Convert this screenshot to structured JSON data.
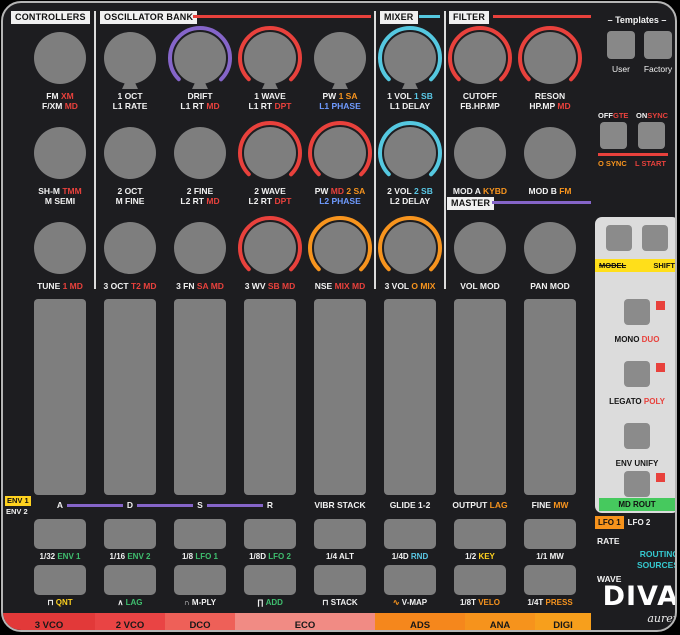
{
  "palette": {
    "w": "#f2f2f2",
    "r": "#e8413c",
    "o": "#f7941e",
    "c": "#5ac8e6",
    "b": "#6f9bff",
    "g": "#3fbf6f",
    "y": "#ffd21f",
    "p": "#8565c9",
    "k": "#141414"
  },
  "arc_colors": {
    "r": "#e8413c",
    "p": "#8565c9",
    "c": "#55c8e0",
    "o": "#f7941e"
  },
  "headers": {
    "controllers": "CONTROLLERS",
    "oscillator_bank": "OSCILLATOR BANK",
    "mixer": "MIXER",
    "filter": "FILTER",
    "master": "MASTER"
  },
  "knob_rows": [
    [
      {
        "l1": [
          [
            "FM ",
            "w"
          ],
          [
            "XM",
            "r"
          ]
        ],
        "l2": [
          [
            "F/XM ",
            "w"
          ],
          [
            "MD",
            "r"
          ]
        ],
        "arc": null,
        "marker": false
      },
      {
        "l1": [
          [
            "1 OCT",
            "w"
          ]
        ],
        "l2": [
          [
            "L1 RATE",
            "w"
          ]
        ],
        "arc": null,
        "marker": true
      },
      {
        "l1": [
          [
            "DRIFT",
            "w"
          ]
        ],
        "l2": [
          [
            "L1 RT ",
            "w"
          ],
          [
            "MD",
            "r"
          ]
        ],
        "arc": "p",
        "marker": true
      },
      {
        "l1": [
          [
            "1 WAVE",
            "w"
          ]
        ],
        "l2": [
          [
            "L1 RT ",
            "w"
          ],
          [
            "DPT",
            "r"
          ]
        ],
        "arc": "r",
        "marker": true
      },
      {
        "l1": [
          [
            "PW ",
            "w"
          ],
          [
            "1 SA",
            "o"
          ]
        ],
        "l2": [
          [
            "L1 PHASE",
            "b"
          ]
        ],
        "arc": null,
        "marker": true
      },
      {
        "l1": [
          [
            "1 VOL ",
            "w"
          ],
          [
            "1 SB",
            "c"
          ]
        ],
        "l2": [
          [
            "L1 DELAY",
            "w"
          ]
        ],
        "arc": "c",
        "marker": true
      },
      {
        "l1": [
          [
            "CUTOFF",
            "w"
          ]
        ],
        "l2": [
          [
            "FB.HP.MP",
            "w"
          ]
        ],
        "arc": "r",
        "marker": false
      },
      {
        "l1": [
          [
            "RESON",
            "w"
          ]
        ],
        "l2": [
          [
            "HP.MP ",
            "w"
          ],
          [
            "MD",
            "r"
          ]
        ],
        "arc": "r",
        "marker": false
      }
    ],
    [
      {
        "l1": [
          [
            "SH-M ",
            "w"
          ],
          [
            "TMM",
            "r"
          ]
        ],
        "l2": [
          [
            "M SEMI",
            "w"
          ]
        ],
        "arc": null,
        "marker": false
      },
      {
        "l1": [
          [
            "2 OCT",
            "w"
          ]
        ],
        "l2": [
          [
            "M FINE",
            "w"
          ]
        ],
        "arc": null,
        "marker": false
      },
      {
        "l1": [
          [
            "2 FINE",
            "w"
          ]
        ],
        "l2": [
          [
            "L2 RT ",
            "w"
          ],
          [
            "MD",
            "r"
          ]
        ],
        "arc": null,
        "marker": false
      },
      {
        "l1": [
          [
            "2 WAVE",
            "w"
          ]
        ],
        "l2": [
          [
            "L2 RT ",
            "w"
          ],
          [
            "DPT",
            "r"
          ]
        ],
        "arc": "r",
        "marker": false
      },
      {
        "l1": [
          [
            "PW ",
            "w"
          ],
          [
            "MD ",
            "r"
          ],
          [
            "2 SA",
            "o"
          ]
        ],
        "l2": [
          [
            "L2 PHASE",
            "b"
          ]
        ],
        "arc": "r",
        "marker": false
      },
      {
        "l1": [
          [
            "2 VOL ",
            "w"
          ],
          [
            "2 SB",
            "c"
          ]
        ],
        "l2": [
          [
            "L2 DELAY",
            "w"
          ]
        ],
        "arc": "c",
        "marker": false
      },
      {
        "l1": [
          [
            "MOD A ",
            "w"
          ],
          [
            "KYBD",
            "o"
          ]
        ],
        "l2": null,
        "arc": null,
        "marker": false
      },
      {
        "l1": [
          [
            "MOD B ",
            "w"
          ],
          [
            "FM",
            "o"
          ]
        ],
        "l2": null,
        "arc": null,
        "marker": false
      }
    ],
    [
      {
        "l1": [
          [
            "TUNE ",
            "w"
          ],
          [
            "1 MD",
            "r"
          ]
        ],
        "l2": null,
        "arc": null,
        "marker": false
      },
      {
        "l1": [
          [
            "3 OCT ",
            "w"
          ],
          [
            "T2 MD",
            "r"
          ]
        ],
        "l2": null,
        "arc": null,
        "marker": false
      },
      {
        "l1": [
          [
            "3 FN ",
            "w"
          ],
          [
            "SA MD",
            "r"
          ]
        ],
        "l2": null,
        "arc": null,
        "marker": false
      },
      {
        "l1": [
          [
            "3 WV ",
            "w"
          ],
          [
            "SB MD",
            "r"
          ]
        ],
        "l2": null,
        "arc": "r",
        "marker": false
      },
      {
        "l1": [
          [
            "NSE ",
            "w"
          ],
          [
            "MIX MD",
            "r"
          ]
        ],
        "l2": null,
        "arc": "o",
        "marker": false
      },
      {
        "l1": [
          [
            "3 VOL ",
            "w"
          ],
          [
            "O MIX",
            "o"
          ]
        ],
        "l2": null,
        "arc": "o",
        "marker": false
      },
      {
        "l1": [
          [
            "VOL MOD",
            "w"
          ]
        ],
        "l2": null,
        "arc": null,
        "marker": false
      },
      {
        "l1": [
          [
            "PAN MOD",
            "w"
          ]
        ],
        "l2": null,
        "arc": null,
        "marker": false
      }
    ]
  ],
  "faders": [
    {
      "label": [
        [
          "A",
          "w"
        ]
      ]
    },
    {
      "label": [
        [
          "D",
          "w"
        ]
      ]
    },
    {
      "label": [
        [
          "S",
          "w"
        ]
      ]
    },
    {
      "label": [
        [
          "R",
          "w"
        ]
      ]
    },
    {
      "label": [
        [
          "VIBR STACK",
          "w"
        ]
      ]
    },
    {
      "label": [
        [
          "GLIDE 1-2",
          "w"
        ]
      ]
    },
    {
      "label": [
        [
          "OUTPUT ",
          "w"
        ],
        [
          "LAG",
          "o"
        ]
      ]
    },
    {
      "label": [
        [
          "FINE ",
          "w"
        ],
        [
          "MW",
          "o"
        ]
      ]
    }
  ],
  "button_row1": [
    {
      "label": [
        [
          "1/32 ",
          "w"
        ],
        [
          "ENV 1",
          "g"
        ]
      ]
    },
    {
      "label": [
        [
          "1/16 ",
          "w"
        ],
        [
          "ENV 2",
          "g"
        ]
      ]
    },
    {
      "label": [
        [
          "1/8 ",
          "w"
        ],
        [
          "LFO 1",
          "g"
        ]
      ]
    },
    {
      "label": [
        [
          "1/8D ",
          "w"
        ],
        [
          "LFO 2",
          "g"
        ]
      ]
    },
    {
      "label": [
        [
          "1/4 ",
          "w"
        ],
        [
          "ALT",
          "w"
        ]
      ]
    },
    {
      "label": [
        [
          "1/4D ",
          "w"
        ],
        [
          "RND",
          "c"
        ]
      ]
    },
    {
      "label": [
        [
          "1/2 ",
          "w"
        ],
        [
          "KEY",
          "y"
        ]
      ]
    },
    {
      "label": [
        [
          "1/1 ",
          "w"
        ],
        [
          "MW",
          "w"
        ]
      ]
    }
  ],
  "button_row2": [
    {
      "label": [
        [
          "⊓ ",
          "w"
        ],
        [
          "QNT",
          "y"
        ]
      ]
    },
    {
      "label": [
        [
          "∧ ",
          "w"
        ],
        [
          "LAG",
          "g"
        ]
      ]
    },
    {
      "label": [
        [
          "∩ ",
          "w"
        ],
        [
          "M-PLY",
          "w"
        ]
      ]
    },
    {
      "label": [
        [
          "∏ ",
          "w"
        ],
        [
          "ADD",
          "g"
        ]
      ]
    },
    {
      "label": [
        [
          "⊓ ",
          "w"
        ],
        [
          "STACK",
          "w"
        ]
      ]
    },
    {
      "label": [
        [
          "∿ ",
          "o"
        ],
        [
          "V-MAP",
          "w"
        ]
      ]
    },
    {
      "label": [
        [
          "1/8T ",
          "w"
        ],
        [
          "VELO",
          "o"
        ]
      ]
    },
    {
      "label": [
        [
          "1/4T ",
          "w"
        ],
        [
          "PRESS",
          "o"
        ]
      ]
    }
  ],
  "footer_segments": [
    {
      "label": "3 VCO",
      "bg": "#e23939"
    },
    {
      "label": "2 VCO",
      "bg": "#e94444"
    },
    {
      "label": "DCO",
      "bg": "#ee6058"
    },
    {
      "label": "ECO",
      "bg": "#f18b84"
    },
    {
      "label": "ADS",
      "bg": "#f5871c"
    },
    {
      "label": "ANA",
      "bg": "#f6931c"
    },
    {
      "label": "DIGI",
      "bg": "#f79f1c"
    }
  ],
  "env_tags": {
    "env1": "ENV 1",
    "env2": "ENV 2"
  },
  "templates": {
    "title": "– Templates –",
    "user": "User",
    "factory": "Factory"
  },
  "sync": {
    "off": "OFF",
    "gte": "GTE",
    "on": "ON",
    "sync": "SYNC",
    "o_sync": "O SYNC",
    "l_start": "L START"
  },
  "side_panel": {
    "model": "MODEL",
    "shift": "SHIFT",
    "rows": [
      {
        "label": [
          [
            "MONO ",
            "k"
          ],
          [
            "DUO",
            "r"
          ]
        ],
        "red_tag": true
      },
      {
        "label": [
          [
            "LEGATO ",
            "k"
          ],
          [
            "POLY",
            "r"
          ]
        ],
        "red_tag": true
      },
      {
        "label": [
          [
            "ENV UNIFY",
            "k"
          ]
        ],
        "red_tag": false
      },
      {
        "label": null,
        "red_tag": true
      }
    ],
    "md_rout": "MD ROUT"
  },
  "lfo_section": {
    "lfo1": "LFO 1",
    "lfo2": "LFO 2",
    "rate": "RATE",
    "routing": "ROUTING",
    "sources": "SOURCES",
    "wave": "WAVE"
  },
  "brand": {
    "logo": "DIVA",
    "maker": "aurex"
  }
}
